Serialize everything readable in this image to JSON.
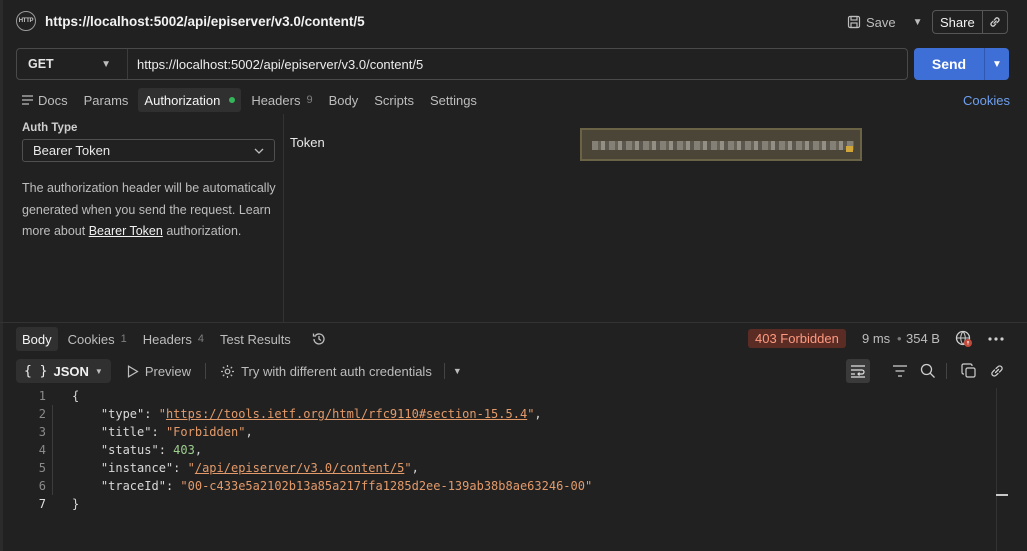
{
  "header": {
    "icon": "http-icon",
    "icon_text": "HTTP",
    "title": "https://localhost:5002/api/episerver/v3.0/content/5",
    "save_label": "Save",
    "share_label": "Share"
  },
  "request": {
    "method": "GET",
    "url": "https://localhost:5002/api/episerver/v3.0/content/5",
    "send_label": "Send",
    "tabs": [
      {
        "label": "Docs"
      },
      {
        "label": "Params"
      },
      {
        "label": "Authorization",
        "active": true
      },
      {
        "label": "Headers",
        "count": "9"
      },
      {
        "label": "Body"
      },
      {
        "label": "Scripts"
      },
      {
        "label": "Settings"
      }
    ],
    "cookies_label": "Cookies"
  },
  "auth": {
    "type_label": "Auth Type",
    "type_value": "Bearer Token",
    "desc_part1": "The authorization header will be automatically generated when you send the request. Learn more about ",
    "desc_link": "Bearer Token",
    "desc_part2": " authorization.",
    "token_label": "Token"
  },
  "response": {
    "tabs": [
      {
        "label": "Body",
        "active": true
      },
      {
        "label": "Cookies",
        "count": "1"
      },
      {
        "label": "Headers",
        "count": "4"
      },
      {
        "label": "Test Results"
      }
    ],
    "status": "403 Forbidden",
    "time": "9 ms",
    "size": "354 B",
    "format": "JSON",
    "preview_label": "Preview",
    "auth_hint": "Try with different auth credentials",
    "json": {
      "type": "https://tools.ietf.org/html/rfc9110#section-15.5.4",
      "title": "Forbidden",
      "status": "403",
      "instance": "/api/episerver/v3.0/content/5",
      "traceId": "00-c433e5a2102b13a85a217ffa1285d2ee-139ab38b8ae63246-00"
    }
  },
  "colors": {
    "accent": "#3e6fd6",
    "status_error_bg": "#5a2c24",
    "status_error_fg": "#ff9a80",
    "link": "#6ea0f0"
  }
}
